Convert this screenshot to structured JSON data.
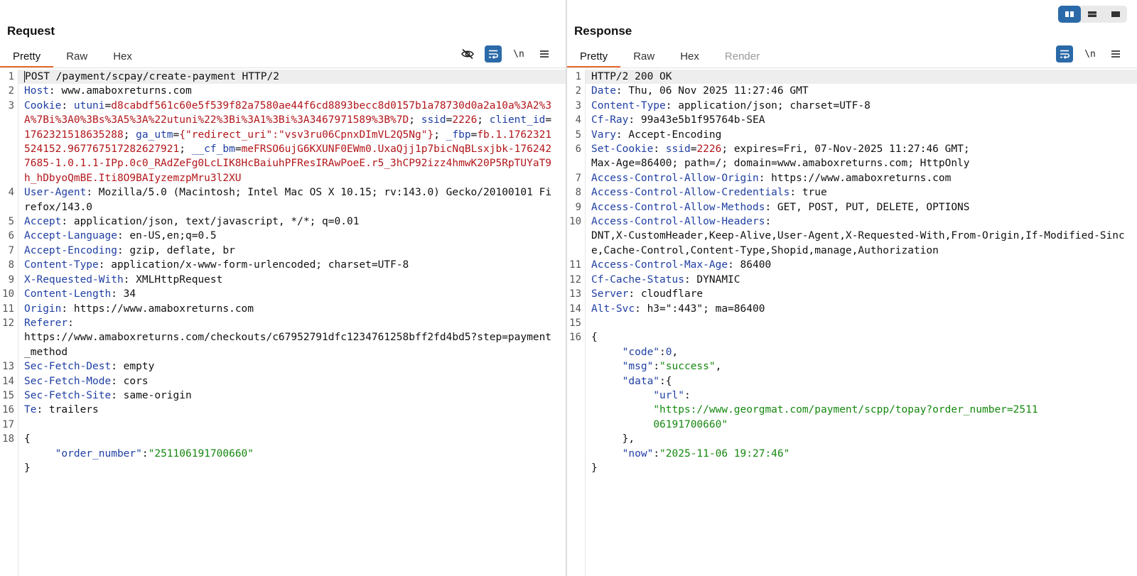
{
  "request": {
    "title": "Request",
    "tabs": [
      {
        "label": "Pretty",
        "active": true
      },
      {
        "label": "Raw",
        "active": false
      },
      {
        "label": "Hex",
        "active": false
      }
    ],
    "tools": {
      "newline_label": "\\n",
      "icons": [
        "hide-eye-icon",
        "word-wrap-icon",
        "newline-toggle",
        "menu-icon"
      ]
    },
    "lines": [
      {
        "n": "1",
        "t": [
          {
            "c": "",
            "s": "POST /payment/scpay/create-payment HTTP/2"
          }
        ]
      },
      {
        "n": "2",
        "t": [
          {
            "c": "k",
            "s": "Host"
          },
          {
            "c": "",
            "s": ": www.amaboxreturns.com"
          }
        ]
      },
      {
        "n": "3",
        "t": [
          {
            "c": "k",
            "s": "Cookie"
          },
          {
            "c": "",
            "s": ": "
          },
          {
            "c": "k",
            "s": "utuni"
          },
          {
            "c": "",
            "s": "="
          },
          {
            "c": "v",
            "s": "d8cabdf561c60e5f539f82a7580ae44f6cd8893becc8d0157b1a78730d0a2a10a%3A2%3A%7Bi%3A0%3Bs%3A5%3A%22utuni%22%3Bi%3A1%3Bi%3A3467971589%3B%7D"
          },
          {
            "c": "",
            "s": "; "
          },
          {
            "c": "k",
            "s": "ssid"
          },
          {
            "c": "",
            "s": "="
          },
          {
            "c": "v",
            "s": "2226"
          },
          {
            "c": "",
            "s": "; "
          },
          {
            "c": "k",
            "s": "client_id"
          },
          {
            "c": "",
            "s": "="
          },
          {
            "c": "v",
            "s": "1762321518635288"
          },
          {
            "c": "",
            "s": "; "
          },
          {
            "c": "k",
            "s": "ga_utm"
          },
          {
            "c": "",
            "s": "="
          },
          {
            "c": "v",
            "s": "{\"redirect_uri\":\"vsv3ru06CpnxDImVL2Q5Ng\"}"
          },
          {
            "c": "",
            "s": "; "
          },
          {
            "c": "k",
            "s": "_fbp"
          },
          {
            "c": "",
            "s": "="
          },
          {
            "c": "v",
            "s": "fb.1.1762321524152.967767517282627921"
          },
          {
            "c": "",
            "s": "; "
          },
          {
            "c": "k",
            "s": "__cf_bm"
          },
          {
            "c": "",
            "s": "="
          },
          {
            "c": "v",
            "s": "meFRSO6ujG6KXUNF0EWm0.UxaQjj1p7bicNqBLsxjbk-1762427685-1.0.1.1-IPp.0c0_RAdZeFg0LcLIK8HcBaiuhPFResIRAwPoeE.r5_3hCP92izz4hmwK20P5RpTUYaT9h_hDbyoQmBE.Iti8O9BAIyzemzpMru3l2XU"
          }
        ]
      },
      {
        "n": "4",
        "t": [
          {
            "c": "k",
            "s": "User-Agent"
          },
          {
            "c": "",
            "s": ": Mozilla/5.0 (Macintosh; Intel Mac OS X 10.15; rv:143.0) Gecko/20100101 Firefox/143.0"
          }
        ]
      },
      {
        "n": "5",
        "t": [
          {
            "c": "k",
            "s": "Accept"
          },
          {
            "c": "",
            "s": ": application/json, text/javascript, */*; q=0.01"
          }
        ]
      },
      {
        "n": "6",
        "t": [
          {
            "c": "k",
            "s": "Accept-Language"
          },
          {
            "c": "",
            "s": ": en-US,en;q=0.5"
          }
        ]
      },
      {
        "n": "7",
        "t": [
          {
            "c": "k",
            "s": "Accept-Encoding"
          },
          {
            "c": "",
            "s": ": gzip, deflate, br"
          }
        ]
      },
      {
        "n": "8",
        "t": [
          {
            "c": "k",
            "s": "Content-Type"
          },
          {
            "c": "",
            "s": ": application/x-www-form-urlencoded; charset=UTF-8"
          }
        ]
      },
      {
        "n": "9",
        "t": [
          {
            "c": "k",
            "s": "X-Requested-With"
          },
          {
            "c": "",
            "s": ": XMLHttpRequest"
          }
        ]
      },
      {
        "n": "10",
        "t": [
          {
            "c": "k",
            "s": "Content-Length"
          },
          {
            "c": "",
            "s": ": 34"
          }
        ]
      },
      {
        "n": "11",
        "t": [
          {
            "c": "k",
            "s": "Origin"
          },
          {
            "c": "",
            "s": ": https://www.amaboxreturns.com"
          }
        ]
      },
      {
        "n": "12",
        "t": [
          {
            "c": "k",
            "s": "Referer"
          },
          {
            "c": "",
            "s": ":\nhttps://www.amaboxreturns.com/checkouts/c67952791dfc1234761258bff2fd4bd5?step=payment_method"
          }
        ]
      },
      {
        "n": "13",
        "t": [
          {
            "c": "k",
            "s": "Sec-Fetch-Dest"
          },
          {
            "c": "",
            "s": ": empty"
          }
        ]
      },
      {
        "n": "14",
        "t": [
          {
            "c": "k",
            "s": "Sec-Fetch-Mode"
          },
          {
            "c": "",
            "s": ": cors"
          }
        ]
      },
      {
        "n": "15",
        "t": [
          {
            "c": "k",
            "s": "Sec-Fetch-Site"
          },
          {
            "c": "",
            "s": ": same-origin"
          }
        ]
      },
      {
        "n": "16",
        "t": [
          {
            "c": "k",
            "s": "Te"
          },
          {
            "c": "",
            "s": ": trailers"
          }
        ]
      },
      {
        "n": "17",
        "t": [
          {
            "c": "",
            "s": ""
          }
        ]
      },
      {
        "n": "18",
        "t": [
          {
            "c": "",
            "s": "{\n     "
          },
          {
            "c": "k",
            "s": "\"order_number\""
          },
          {
            "c": "",
            "s": ":"
          },
          {
            "c": "s",
            "s": "\"251106191700660\""
          },
          {
            "c": "",
            "s": "\n}"
          }
        ]
      }
    ]
  },
  "response": {
    "title": "Response",
    "tabs": [
      {
        "label": "Pretty",
        "active": true
      },
      {
        "label": "Raw",
        "active": false
      },
      {
        "label": "Hex",
        "active": false
      },
      {
        "label": "Render",
        "active": false,
        "disabled": true
      }
    ],
    "tools": {
      "newline_label": "\\n",
      "icons": [
        "word-wrap-icon",
        "newline-toggle",
        "menu-icon"
      ]
    },
    "lines": [
      {
        "n": "1",
        "t": [
          {
            "c": "",
            "s": "HTTP/2 200 OK"
          }
        ]
      },
      {
        "n": "2",
        "t": [
          {
            "c": "k",
            "s": "Date"
          },
          {
            "c": "",
            "s": ": Thu, 06 Nov 2025 11:27:46 GMT"
          }
        ]
      },
      {
        "n": "3",
        "t": [
          {
            "c": "k",
            "s": "Content-Type"
          },
          {
            "c": "",
            "s": ": application/json; charset=UTF-8"
          }
        ]
      },
      {
        "n": "4",
        "t": [
          {
            "c": "k",
            "s": "Cf-Ray"
          },
          {
            "c": "",
            "s": ": 99a43e5b1f95764b-SEA"
          }
        ]
      },
      {
        "n": "5",
        "t": [
          {
            "c": "k",
            "s": "Vary"
          },
          {
            "c": "",
            "s": ": Accept-Encoding"
          }
        ]
      },
      {
        "n": "6",
        "t": [
          {
            "c": "k",
            "s": "Set-Cookie"
          },
          {
            "c": "",
            "s": ": "
          },
          {
            "c": "k",
            "s": "ssid"
          },
          {
            "c": "",
            "s": "="
          },
          {
            "c": "v",
            "s": "2226"
          },
          {
            "c": "",
            "s": "; expires=Fri, 07-Nov-2025 11:27:46 GMT;\nMax-Age=86400; path=/; domain=www.amaboxreturns.com; HttpOnly"
          }
        ]
      },
      {
        "n": "7",
        "t": [
          {
            "c": "k",
            "s": "Access-Control-Allow-Origin"
          },
          {
            "c": "",
            "s": ": https://www.amaboxreturns.com"
          }
        ]
      },
      {
        "n": "8",
        "t": [
          {
            "c": "k",
            "s": "Access-Control-Allow-Credentials"
          },
          {
            "c": "",
            "s": ": true"
          }
        ]
      },
      {
        "n": "9",
        "t": [
          {
            "c": "k",
            "s": "Access-Control-Allow-Methods"
          },
          {
            "c": "",
            "s": ": GET, POST, PUT, DELETE, OPTIONS"
          }
        ]
      },
      {
        "n": "10",
        "t": [
          {
            "c": "k",
            "s": "Access-Control-Allow-Headers"
          },
          {
            "c": "",
            "s": ":\nDNT,X-CustomHeader,Keep-Alive,User-Agent,X-Requested-With,From-Origin,If-Modified-Since,Cache-Control,Content-Type,Shopid,manage,Authorization"
          }
        ]
      },
      {
        "n": "11",
        "t": [
          {
            "c": "k",
            "s": "Access-Control-Max-Age"
          },
          {
            "c": "",
            "s": ": 86400"
          }
        ]
      },
      {
        "n": "12",
        "t": [
          {
            "c": "k",
            "s": "Cf-Cache-Status"
          },
          {
            "c": "",
            "s": ": DYNAMIC"
          }
        ]
      },
      {
        "n": "13",
        "t": [
          {
            "c": "k",
            "s": "Server"
          },
          {
            "c": "",
            "s": ": cloudflare"
          }
        ]
      },
      {
        "n": "14",
        "t": [
          {
            "c": "k",
            "s": "Alt-Svc"
          },
          {
            "c": "",
            "s": ": h3=\":443\"; ma=86400"
          }
        ]
      },
      {
        "n": "15",
        "t": [
          {
            "c": "",
            "s": ""
          }
        ]
      },
      {
        "n": "16",
        "t": [
          {
            "c": "",
            "s": "{\n     "
          },
          {
            "c": "k",
            "s": "\"code\""
          },
          {
            "c": "",
            "s": ":"
          },
          {
            "c": "n",
            "s": "0"
          },
          {
            "c": "",
            "s": ",\n     "
          },
          {
            "c": "k",
            "s": "\"msg\""
          },
          {
            "c": "",
            "s": ":"
          },
          {
            "c": "s",
            "s": "\"success\""
          },
          {
            "c": "",
            "s": ",\n     "
          },
          {
            "c": "k",
            "s": "\"data\""
          },
          {
            "c": "",
            "s": ":{\n          "
          },
          {
            "c": "k",
            "s": "\"url\""
          },
          {
            "c": "",
            "s": ":\n          "
          },
          {
            "c": "s",
            "s": "\"https://www.georgmat.com/payment/scpp/topay?order_number=2511\n          06191700660\""
          },
          {
            "c": "",
            "s": "\n     },\n     "
          },
          {
            "c": "k",
            "s": "\"now\""
          },
          {
            "c": "",
            "s": ":"
          },
          {
            "c": "s",
            "s": "\"2025-11-06 19:27:46\""
          },
          {
            "c": "",
            "s": "\n}"
          }
        ]
      }
    ]
  },
  "layout_switch": {
    "icons": [
      "split-columns-icon",
      "split-rows-icon",
      "single-pane-icon"
    ],
    "active": "split-columns-icon"
  },
  "colors": {
    "accent_tab": "#e8692a",
    "toggle_on": "#2b6aa8",
    "header_name": "#1f3fa3",
    "cookie_value": "#b3161a",
    "json_string": "#15880f"
  }
}
